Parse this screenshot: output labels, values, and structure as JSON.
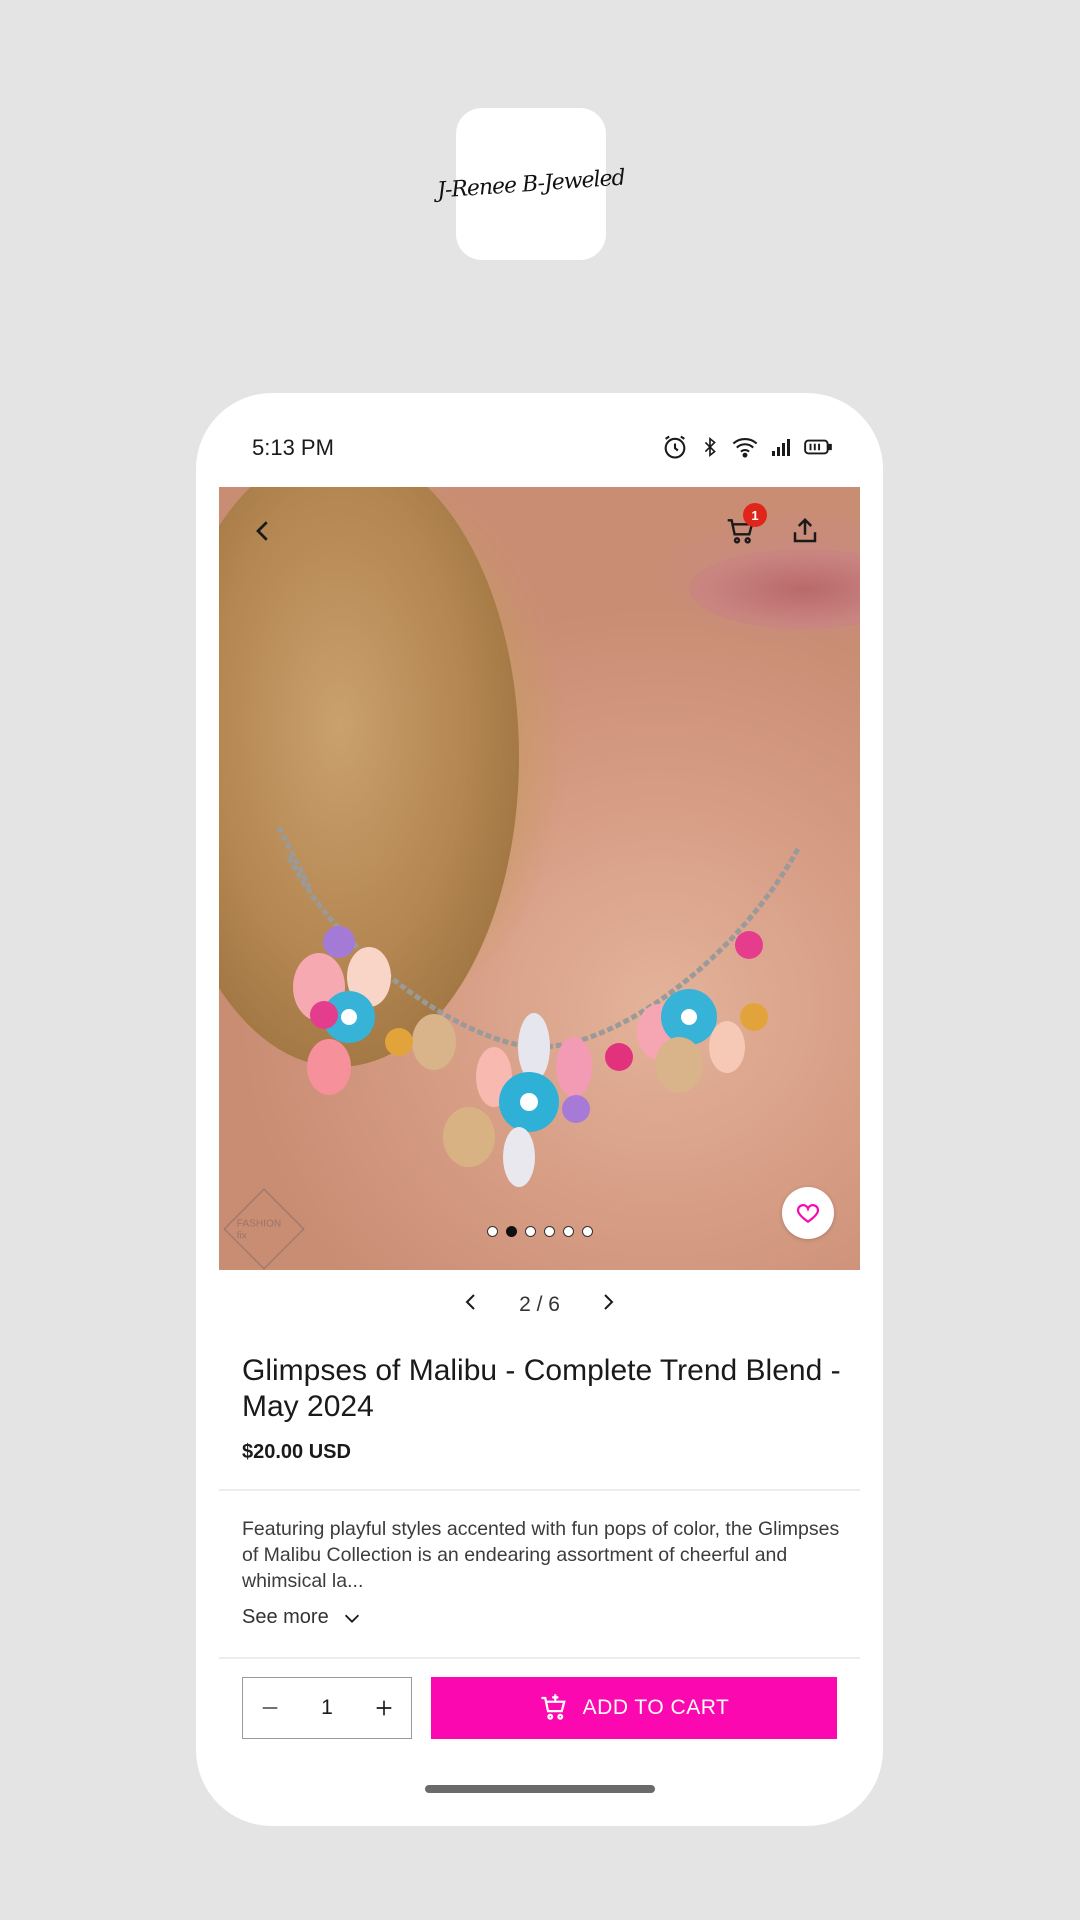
{
  "brand": {
    "logo_text": "J-Renee B-Jeweled"
  },
  "status_bar": {
    "time": "5:13 PM",
    "icons": [
      "alarm-icon",
      "bluetooth-icon",
      "wifi-icon",
      "signal-icon",
      "battery-icon"
    ]
  },
  "top_nav": {
    "back_icon": "chevron-left-icon",
    "cart_icon": "cart-icon",
    "cart_count": "1",
    "share_icon": "share-icon"
  },
  "gallery": {
    "current_index": 2,
    "total": 6,
    "pager_text": "2 / 6",
    "watermark_text": "FASHION fix",
    "favorite_icon": "heart-icon"
  },
  "product": {
    "title": "Glimpses of Malibu - Complete Trend Blend - May 2024",
    "price": "$20.00 USD",
    "description": "Featuring playful styles accented with fun pops of color, the Glimpses of Malibu Collection is an endearing assortment of cheerful and whimsical la...",
    "see_more_label": "See more"
  },
  "purchase": {
    "quantity": "1",
    "add_to_cart_label": "ADD TO CART"
  },
  "colors": {
    "accent": "#fb08b1",
    "badge": "#e0261b",
    "background": "#e4e4e4"
  }
}
